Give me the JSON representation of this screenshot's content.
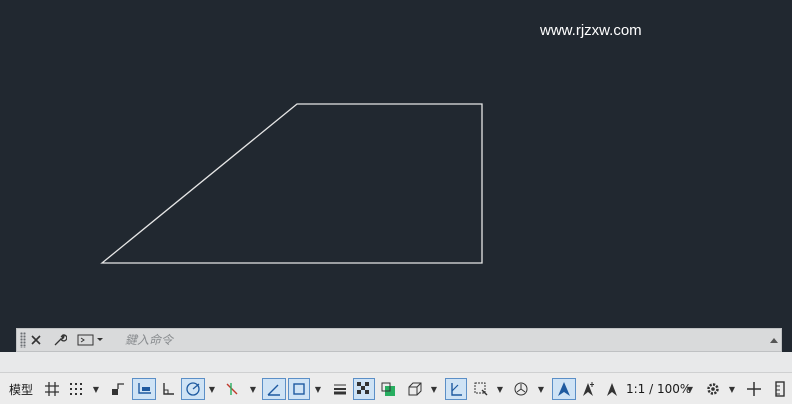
{
  "watermark": "www.rjzxw.com",
  "command_line": {
    "placeholder": "鍵入命令"
  },
  "statusbar": {
    "model_tab": "模型",
    "annotation_scale": "1:1 / 100%"
  },
  "colors": {
    "viewport_bg": "#212830",
    "drawing_stroke": "#e6e6e6",
    "active_button_bg": "#cfe3f5",
    "active_button_border": "#5b8fc7"
  },
  "icons": [
    "close-icon",
    "wrench-icon",
    "command-prompt-icon",
    "chevron-up-icon",
    "grid-icon",
    "snap-grid-icon",
    "infer-constraints-icon",
    "dynamic-input-icon",
    "ortho-icon",
    "polar-tracking-icon",
    "isodraft-icon",
    "object-snap-tracking-icon",
    "object-snap-icon",
    "lineweight-icon",
    "transparency-icon",
    "selection-cycling-icon",
    "3d-object-snap-icon",
    "dynamic-ucs-icon",
    "selection-filter-icon",
    "gizmo-icon",
    "annotation-visibility-icon",
    "auto-scale-icon",
    "annotation-scale-icon",
    "gear-icon",
    "plus-icon",
    "customize-icon"
  ]
}
